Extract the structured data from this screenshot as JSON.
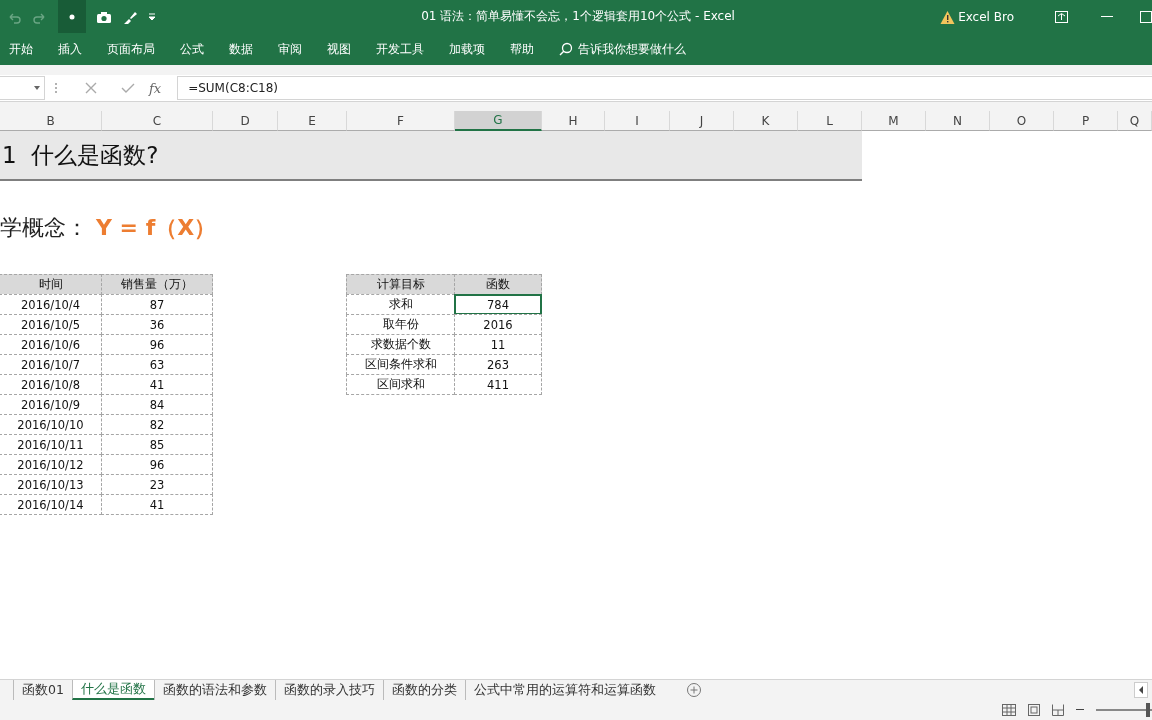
{
  "window": {
    "title": "01 语法：简单易懂不会忘，1个逻辑套用10个公式  -  Excel",
    "user": "Excel Bro"
  },
  "ribbon_tabs": [
    "开始",
    "插入",
    "页面布局",
    "公式",
    "数据",
    "审阅",
    "视图",
    "开发工具",
    "加载项",
    "帮助"
  ],
  "tell_me": {
    "placeholder": "告诉我你想要做什么"
  },
  "formula_bar": {
    "fx": "fx",
    "formula": "=SUM(C8:C18)"
  },
  "columns": [
    {
      "label": "B",
      "selected": false
    },
    {
      "label": "C",
      "selected": false
    },
    {
      "label": "D",
      "selected": false
    },
    {
      "label": "E",
      "selected": false
    },
    {
      "label": "F",
      "selected": false
    },
    {
      "label": "G",
      "selected": true
    },
    {
      "label": "H",
      "selected": false
    },
    {
      "label": "I",
      "selected": false
    },
    {
      "label": "J",
      "selected": false
    },
    {
      "label": "K",
      "selected": false
    },
    {
      "label": "L",
      "selected": false
    },
    {
      "label": "M",
      "selected": false
    },
    {
      "label": "N",
      "selected": false
    },
    {
      "label": "O",
      "selected": false
    },
    {
      "label": "P",
      "selected": false
    },
    {
      "label": "Q",
      "selected": false
    }
  ],
  "sheet": {
    "heading": "1  什么是函数?",
    "concept_label": "学概念：",
    "concept_formula": "Y = f（X）"
  },
  "sales_table": {
    "columns": [
      "时间",
      "销售量（万）"
    ],
    "rows": [
      [
        "2016/10/4",
        "87"
      ],
      [
        "2016/10/5",
        "36"
      ],
      [
        "2016/10/6",
        "96"
      ],
      [
        "2016/10/7",
        "63"
      ],
      [
        "2016/10/8",
        "41"
      ],
      [
        "2016/10/9",
        "84"
      ],
      [
        "2016/10/10",
        "82"
      ],
      [
        "2016/10/11",
        "85"
      ],
      [
        "2016/10/12",
        "96"
      ],
      [
        "2016/10/13",
        "23"
      ],
      [
        "2016/10/14",
        "41"
      ]
    ]
  },
  "calc_table": {
    "columns": [
      "计算目标",
      "函数"
    ],
    "rows": [
      {
        "goal": "求和",
        "value": "784",
        "selected": true
      },
      {
        "goal": "取年份",
        "value": "2016",
        "selected": false
      },
      {
        "goal": "求数据个数",
        "value": "11",
        "selected": false
      },
      {
        "goal": "区间条件求和",
        "value": "263",
        "selected": false
      },
      {
        "goal": "区间求和",
        "value": "411",
        "selected": false
      }
    ]
  },
  "sheet_tabs": [
    {
      "label": "函数01",
      "selected": false
    },
    {
      "label": "什么是函数",
      "selected": true
    },
    {
      "label": "函数的语法和参数",
      "selected": false
    },
    {
      "label": "函数的录入技巧",
      "selected": false
    },
    {
      "label": "函数的分类",
      "selected": false
    },
    {
      "label": "公式中常用的运算符和运算函数",
      "selected": false
    }
  ],
  "zoom_slider": {
    "level": 0.45
  }
}
